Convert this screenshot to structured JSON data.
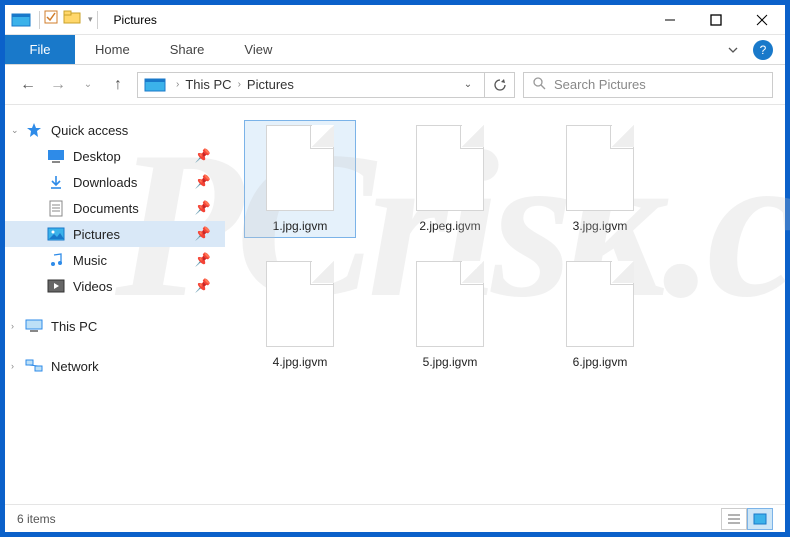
{
  "titlebar": {
    "title": "Pictures"
  },
  "ribbon": {
    "file": "File",
    "tabs": [
      "Home",
      "Share",
      "View"
    ]
  },
  "breadcrumb": {
    "items": [
      "This PC",
      "Pictures"
    ]
  },
  "search": {
    "placeholder": "Search Pictures"
  },
  "nav": {
    "quick_access": "Quick access",
    "items": [
      {
        "label": "Desktop",
        "icon": "desktop"
      },
      {
        "label": "Downloads",
        "icon": "downloads"
      },
      {
        "label": "Documents",
        "icon": "documents"
      },
      {
        "label": "Pictures",
        "icon": "pictures",
        "selected": true
      },
      {
        "label": "Music",
        "icon": "music"
      },
      {
        "label": "Videos",
        "icon": "videos"
      }
    ],
    "this_pc": "This PC",
    "network": "Network"
  },
  "files": [
    {
      "name": "1.jpg.igvm",
      "selected": true
    },
    {
      "name": "2.jpeg.igvm"
    },
    {
      "name": "3.jpg.igvm"
    },
    {
      "name": "4.jpg.igvm"
    },
    {
      "name": "5.jpg.igvm"
    },
    {
      "name": "6.jpg.igvm"
    }
  ],
  "status": {
    "count": "6 items"
  }
}
